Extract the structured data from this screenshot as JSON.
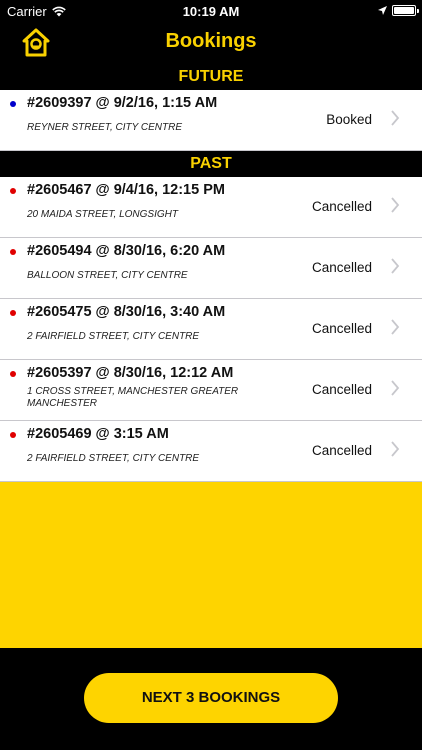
{
  "status_bar": {
    "carrier": "Carrier",
    "time": "10:19 AM"
  },
  "header": {
    "title": "Bookings"
  },
  "sections": {
    "future": "FUTURE",
    "past": "PAST"
  },
  "colors": {
    "accent": "#fed400",
    "title": "#f9d100",
    "future_dot": "#0000cc",
    "past_dot": "#e00000"
  },
  "future_bookings": [
    {
      "ref": "#2609397 @ 9/2/16, 1:15 AM",
      "address": "REYNER STREET, CITY CENTRE",
      "status": "Booked"
    }
  ],
  "past_bookings": [
    {
      "ref": "#2605467 @ 9/4/16, 12:15 PM",
      "address": "20 MAIDA STREET, LONGSIGHT",
      "status": "Cancelled"
    },
    {
      "ref": "#2605494 @ 8/30/16, 6:20 AM",
      "address": "BALLOON STREET, CITY CENTRE",
      "status": "Cancelled"
    },
    {
      "ref": "#2605475 @ 8/30/16, 3:40 AM",
      "address": "2 FAIRFIELD STREET, CITY CENTRE",
      "status": "Cancelled"
    },
    {
      "ref": "#2605397 @ 8/30/16, 12:12 AM",
      "address": "1 CROSS STREET, MANCHESTER GREATER MANCHESTER",
      "status": "Cancelled"
    },
    {
      "ref": "#2605469 @ 3:15 AM",
      "address": "2 FAIRFIELD STREET, CITY CENTRE",
      "status": "Cancelled"
    }
  ],
  "footer": {
    "next_button": "NEXT 3 BOOKINGS"
  }
}
